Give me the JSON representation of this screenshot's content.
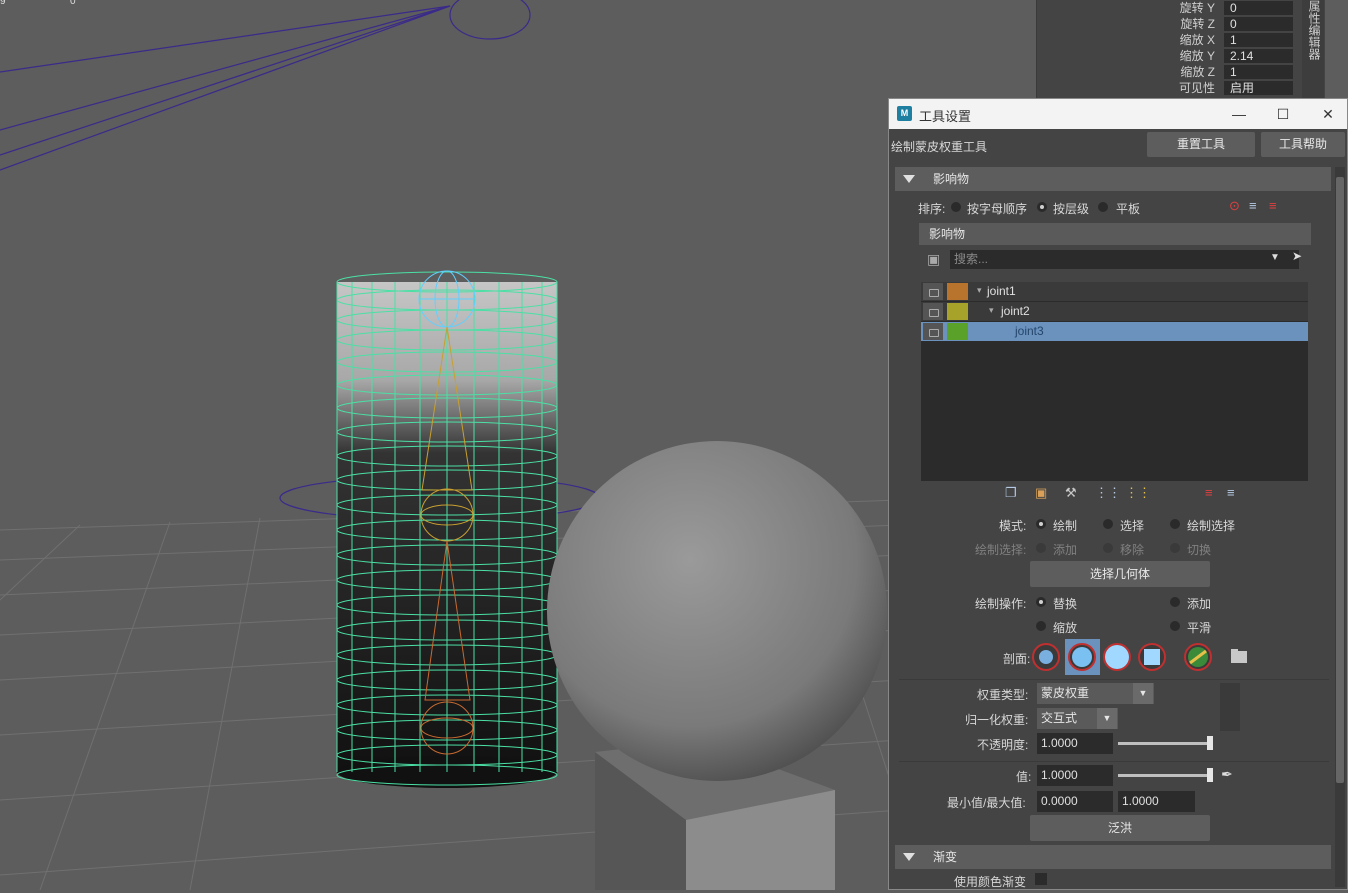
{
  "attribute_editor": {
    "rows": [
      {
        "label": "旋转 Y",
        "value": "0"
      },
      {
        "label": "旋转 Z",
        "value": "0"
      },
      {
        "label": "缩放 X",
        "value": "1"
      },
      {
        "label": "缩放 Y",
        "value": "2.14"
      },
      {
        "label": "缩放 Z",
        "value": "1"
      },
      {
        "label": "可见性",
        "value": "启用"
      }
    ],
    "side_tab": "属性编辑器"
  },
  "viewport": {
    "corner_text_a": "9",
    "corner_text_b": "0"
  },
  "window": {
    "title": "工具设置",
    "tool_name": "绘制蒙皮权重工具",
    "reset_button": "重置工具",
    "help_button": "工具帮助"
  },
  "influences_section": {
    "header": "影响物",
    "sort_label": "排序:",
    "sort_options": [
      "按字母顺序",
      "按层级",
      "平板"
    ],
    "sort_selected": "按层级",
    "list_header": "影响物",
    "search_placeholder": "搜索...",
    "items": [
      {
        "name": "joint1",
        "color": "#b8732d",
        "selected": false
      },
      {
        "name": "joint2",
        "color": "#a7a32a",
        "selected": false
      },
      {
        "name": "joint3",
        "color": "#5aa12a",
        "selected": true
      }
    ]
  },
  "mode": {
    "label": "模式:",
    "options": [
      "绘制",
      "选择",
      "绘制选择"
    ],
    "selected": "绘制"
  },
  "paint_select": {
    "label": "绘制选择:",
    "options": [
      "添加",
      "移除",
      "切换"
    ]
  },
  "select_geometry_button": "选择几何体",
  "paint_operation": {
    "label": "绘制操作:",
    "options": [
      "替换",
      "添加",
      "缩放",
      "平滑"
    ],
    "selected": "替换"
  },
  "profile_label": "剖面:",
  "weight_type": {
    "label": "权重类型:",
    "value": "蒙皮权重"
  },
  "normalize": {
    "label": "归一化权重:",
    "value": "交互式"
  },
  "opacity": {
    "label": "不透明度:",
    "value": "1.0000"
  },
  "value_field": {
    "label": "值:",
    "value": "1.0000"
  },
  "minmax": {
    "label": "最小值/最大值:",
    "min": "0.0000",
    "max": "1.0000"
  },
  "flood_button": "泛洪",
  "gradient_section": {
    "header": "渐变",
    "use_color_ramp": "使用颜色渐变"
  }
}
